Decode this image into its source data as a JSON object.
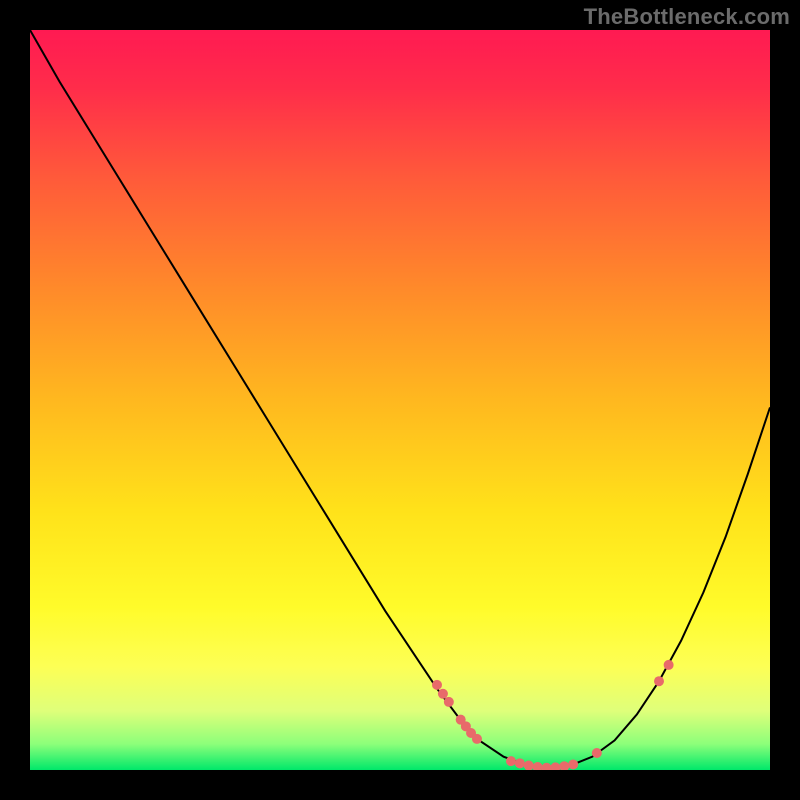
{
  "watermark": "TheBottleneck.com",
  "chart_data": {
    "type": "line",
    "title": "",
    "xlabel": "",
    "ylabel": "",
    "xlim": [
      0,
      100
    ],
    "ylim": [
      0,
      100
    ],
    "gradient_stops": [
      {
        "offset": 0.0,
        "color": "#ff1a52"
      },
      {
        "offset": 0.08,
        "color": "#ff2d4a"
      },
      {
        "offset": 0.2,
        "color": "#ff5a3a"
      },
      {
        "offset": 0.35,
        "color": "#ff8a2a"
      },
      {
        "offset": 0.5,
        "color": "#ffb81f"
      },
      {
        "offset": 0.65,
        "color": "#ffe21a"
      },
      {
        "offset": 0.78,
        "color": "#fffb2a"
      },
      {
        "offset": 0.86,
        "color": "#fdff55"
      },
      {
        "offset": 0.92,
        "color": "#dfff7a"
      },
      {
        "offset": 0.965,
        "color": "#8cff7a"
      },
      {
        "offset": 1.0,
        "color": "#00e86a"
      }
    ],
    "curve": [
      {
        "x": 0.0,
        "y": 100.0
      },
      {
        "x": 4.0,
        "y": 93.0
      },
      {
        "x": 8.0,
        "y": 86.5
      },
      {
        "x": 12.0,
        "y": 80.0
      },
      {
        "x": 16.0,
        "y": 73.5
      },
      {
        "x": 20.0,
        "y": 67.0
      },
      {
        "x": 24.0,
        "y": 60.5
      },
      {
        "x": 28.0,
        "y": 54.0
      },
      {
        "x": 32.0,
        "y": 47.5
      },
      {
        "x": 36.0,
        "y": 41.0
      },
      {
        "x": 40.0,
        "y": 34.5
      },
      {
        "x": 44.0,
        "y": 28.0
      },
      {
        "x": 48.0,
        "y": 21.5
      },
      {
        "x": 52.0,
        "y": 15.5
      },
      {
        "x": 55.0,
        "y": 11.0
      },
      {
        "x": 58.0,
        "y": 7.0
      },
      {
        "x": 61.0,
        "y": 3.8
      },
      {
        "x": 64.0,
        "y": 1.8
      },
      {
        "x": 67.0,
        "y": 0.7
      },
      {
        "x": 70.0,
        "y": 0.3
      },
      {
        "x": 73.0,
        "y": 0.6
      },
      {
        "x": 76.0,
        "y": 1.8
      },
      {
        "x": 79.0,
        "y": 4.0
      },
      {
        "x": 82.0,
        "y": 7.5
      },
      {
        "x": 85.0,
        "y": 12.0
      },
      {
        "x": 88.0,
        "y": 17.5
      },
      {
        "x": 91.0,
        "y": 24.0
      },
      {
        "x": 94.0,
        "y": 31.5
      },
      {
        "x": 97.0,
        "y": 40.0
      },
      {
        "x": 100.0,
        "y": 49.0
      }
    ],
    "markers": [
      {
        "x": 55.0,
        "y": 11.5,
        "r": 5
      },
      {
        "x": 55.8,
        "y": 10.3,
        "r": 5
      },
      {
        "x": 56.6,
        "y": 9.2,
        "r": 5
      },
      {
        "x": 58.2,
        "y": 6.8,
        "r": 5
      },
      {
        "x": 58.9,
        "y": 5.9,
        "r": 5
      },
      {
        "x": 59.6,
        "y": 5.0,
        "r": 5
      },
      {
        "x": 60.4,
        "y": 4.2,
        "r": 5
      },
      {
        "x": 65.0,
        "y": 1.2,
        "r": 5
      },
      {
        "x": 66.2,
        "y": 0.9,
        "r": 5
      },
      {
        "x": 67.4,
        "y": 0.6,
        "r": 5
      },
      {
        "x": 68.6,
        "y": 0.4,
        "r": 5
      },
      {
        "x": 69.8,
        "y": 0.3,
        "r": 5
      },
      {
        "x": 71.0,
        "y": 0.35,
        "r": 5
      },
      {
        "x": 72.2,
        "y": 0.5,
        "r": 5
      },
      {
        "x": 73.4,
        "y": 0.75,
        "r": 5
      },
      {
        "x": 76.6,
        "y": 2.3,
        "r": 5
      },
      {
        "x": 85.0,
        "y": 12.0,
        "r": 5
      },
      {
        "x": 86.3,
        "y": 14.2,
        "r": 5
      }
    ],
    "marker_color": "#e86a6a",
    "line_color": "#000000"
  }
}
